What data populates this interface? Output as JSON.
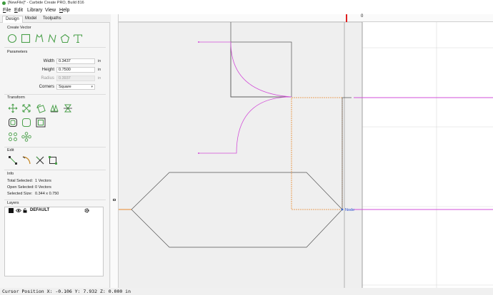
{
  "window": {
    "title": "[NewFile]* - Carbide Create PRO, Build 816"
  },
  "menu": [
    {
      "key": "F",
      "rest": "ile"
    },
    {
      "key": "E",
      "rest": "dit"
    },
    {
      "key": "",
      "rest": "Library"
    },
    {
      "key": "",
      "rest": "View"
    },
    {
      "key": "H",
      "rest": "elp"
    }
  ],
  "tabs": [
    "Design",
    "Model",
    "Toolpaths"
  ],
  "sections": {
    "create_vector": "Create Vector",
    "parameters": "Parameters",
    "transform": "Transform",
    "edit": "Edit",
    "info": "Info",
    "layers": "Layers"
  },
  "params": {
    "width": {
      "label": "Width",
      "value": "0.3437",
      "unit": "in"
    },
    "height": {
      "label": "Height",
      "value": "0.7500",
      "unit": "in"
    },
    "radius": {
      "label": "Radius",
      "value": "0.3937",
      "unit": "in"
    },
    "corners": {
      "label": "Corners",
      "value": "Square"
    }
  },
  "info": {
    "total_selected": {
      "label": "Total Selected:",
      "value": "1 Vectors"
    },
    "open_selected": {
      "label": "Open Selected:",
      "value": "0 Vectors"
    },
    "selected_size": {
      "label": "Selected Size:",
      "value": "0.344 x 0.750"
    }
  },
  "layers": [
    {
      "name": "DEFAULT",
      "visible": true,
      "locked": true
    }
  ],
  "canvas": {
    "ruler_origin_label": "0",
    "node_label": "Node"
  },
  "colors": {
    "accent_green": "#4aa04a",
    "selection_orange": "#e8882c",
    "magenta": "#d24fd8",
    "stock_gray": "#efefef",
    "ruler_marker_red": "#e02020"
  },
  "status": {
    "cursor": "Cursor Position X: -0.106 Y: 7.932 Z: 0.000 in"
  }
}
